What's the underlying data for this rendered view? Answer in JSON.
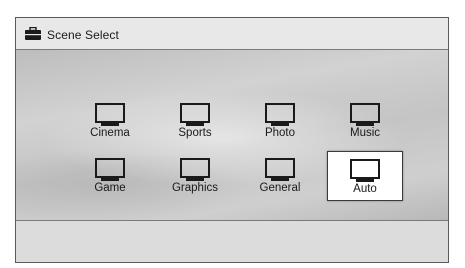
{
  "header": {
    "icon": "toolbox-icon",
    "title": "Scene Select"
  },
  "scenes": [
    {
      "label": "Cinema",
      "icon": "tv-icon",
      "selected": false
    },
    {
      "label": "Sports",
      "icon": "tv-icon",
      "selected": false
    },
    {
      "label": "Photo",
      "icon": "tv-icon",
      "selected": false
    },
    {
      "label": "Music",
      "icon": "tv-icon",
      "selected": false
    },
    {
      "label": "Game",
      "icon": "tv-icon",
      "selected": false
    },
    {
      "label": "Graphics",
      "icon": "tv-icon",
      "selected": false
    },
    {
      "label": "General",
      "icon": "tv-icon",
      "selected": false
    },
    {
      "label": "Auto",
      "icon": "tv-icon",
      "selected": true
    }
  ],
  "colors": {
    "selected_background": "#ffffff",
    "selected_border": "#3a3a3a",
    "panel_background": "#d9d9d9"
  }
}
